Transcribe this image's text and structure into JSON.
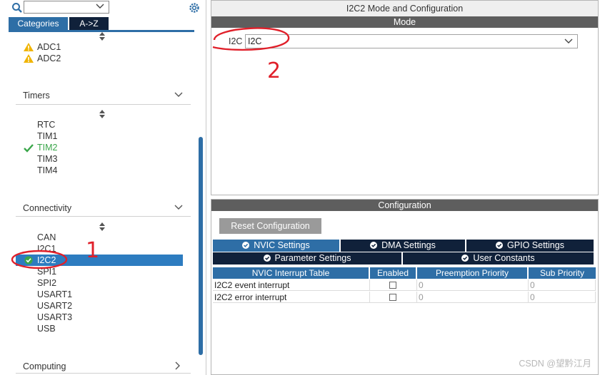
{
  "sidebar": {
    "tabs": {
      "categories": "Categories",
      "az": "A->Z"
    },
    "analog": {
      "items": [
        "ADC1",
        "ADC2"
      ]
    },
    "timers": {
      "title": "Timers",
      "items": [
        "RTC",
        "TIM1",
        "TIM2",
        "TIM3",
        "TIM4"
      ]
    },
    "connectivity": {
      "title": "Connectivity",
      "items": [
        "CAN",
        "I2C1",
        "I2C2",
        "SPI1",
        "SPI2",
        "USART1",
        "USART2",
        "USART3",
        "USB"
      ]
    },
    "computing": {
      "title": "Computing"
    }
  },
  "mode_panel": {
    "title": "I2C2 Mode and Configuration",
    "mode_header": "Mode",
    "i2c_label": "I2C",
    "i2c_value": "I2C"
  },
  "config_panel": {
    "header": "Configuration",
    "reset_label": "Reset Configuration",
    "tabs": {
      "nvic": "NVIC Settings",
      "dma": "DMA Settings",
      "gpio": "GPIO Settings",
      "parameter": "Parameter Settings",
      "user_constants": "User Constants"
    },
    "table": {
      "headers": [
        "NVIC Interrupt Table",
        "Enabled",
        "Preemption Priority",
        "Sub Priority"
      ],
      "rows": [
        {
          "name": "I2C2 event interrupt",
          "preemption": "0",
          "sub": "0"
        },
        {
          "name": "I2C2 error interrupt",
          "preemption": "0",
          "sub": "0"
        }
      ]
    }
  },
  "annotations": {
    "one": "1",
    "two": "2"
  },
  "watermark": "CSDN @望黔江月",
  "colors": {
    "accent": "#2e6ea6",
    "dark_tab": "#10213a",
    "header_gray": "#5e5e5e",
    "ok_green": "#3aa64a",
    "warn_yellow": "#f0b400",
    "anno_red": "#e0202a"
  }
}
